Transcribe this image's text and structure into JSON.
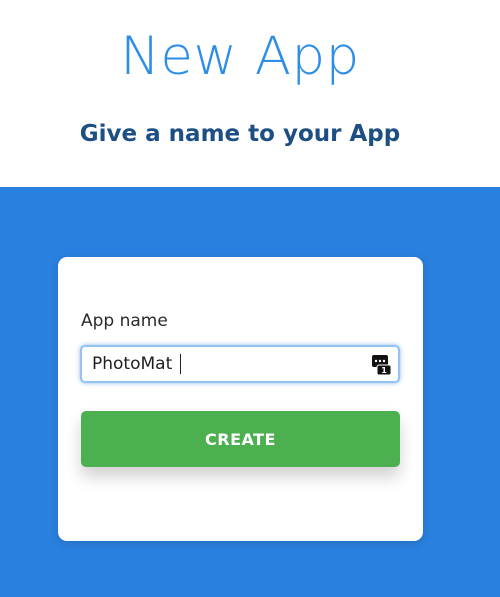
{
  "header": {
    "title": "New App",
    "subtitle": "Give a name to your App"
  },
  "form": {
    "app_name_label": "App name",
    "app_name_value": "PhotoMat",
    "app_name_icon": "password-manager-icon",
    "create_label": "CREATE"
  },
  "colors": {
    "title": "#2d8ee6",
    "subtitle": "#1d4f82",
    "background_blue": "#2a80de",
    "create_button": "#4caf50"
  }
}
